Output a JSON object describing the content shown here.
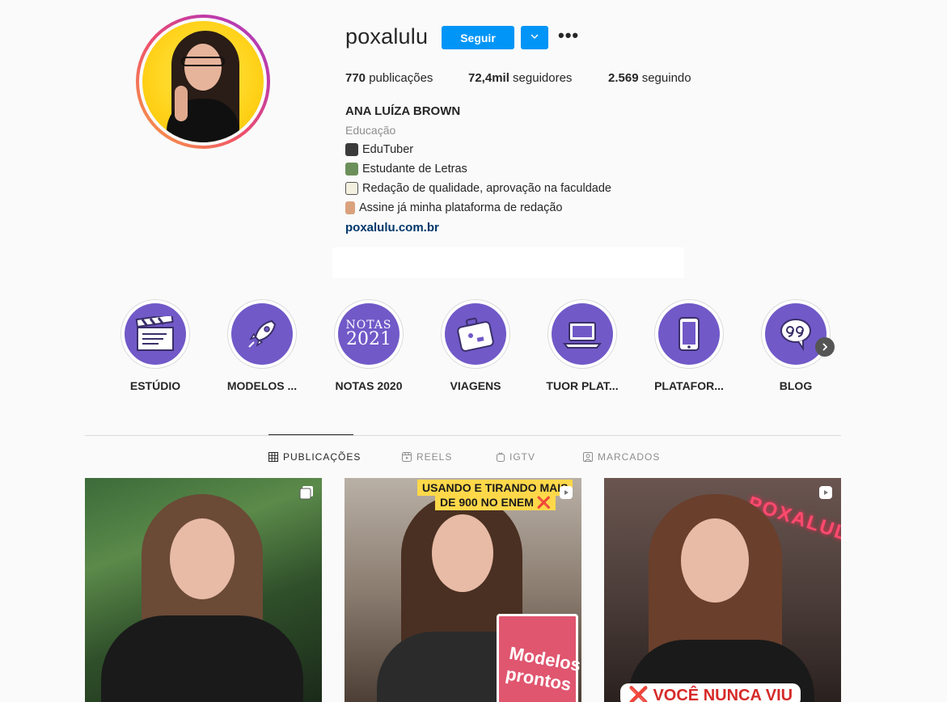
{
  "profile": {
    "username": "poxalulu",
    "follow_label": "Seguir",
    "stats": {
      "posts_count": "770",
      "posts_label": "publicações",
      "followers_count": "72,4mil",
      "followers_label": "seguidores",
      "following_count": "2.569",
      "following_label": "seguindo"
    },
    "full_name": "ANA LUÍZA BROWN",
    "category": "Educação",
    "bio": [
      {
        "text": "EduTuber",
        "icon": "school-bus-emoji"
      },
      {
        "text": "Estudante de Letras",
        "icon": "student-emoji"
      },
      {
        "text": "Redação de qualidade, aprovação na faculdade",
        "icon": "memo-emoji"
      },
      {
        "text": "Assine já minha plataforma de redação",
        "icon": "pointing-down-emoji"
      }
    ],
    "website": "poxalulu.com.br"
  },
  "highlights": [
    {
      "label": "ESTÚDIO",
      "icon": "clapperboard-icon"
    },
    {
      "label": "MODELOS ...",
      "icon": "rocket-icon"
    },
    {
      "label": "NOTAS 2020",
      "icon": "notas-2021-text",
      "cover_text_line1": "NOTAS",
      "cover_text_line2": "2021"
    },
    {
      "label": "VIAGENS",
      "icon": "suitcase-icon"
    },
    {
      "label": "TUOR PLAT...",
      "icon": "laptop-icon"
    },
    {
      "label": "PLATAFOR...",
      "icon": "tablet-icon"
    },
    {
      "label": "BLOG",
      "icon": "speech-bubble-quote-icon"
    }
  ],
  "tabs": [
    {
      "label": "PUBLICAÇÕES",
      "active": true,
      "icon": "grid-icon"
    },
    {
      "label": "REELS",
      "active": false,
      "icon": "reels-icon"
    },
    {
      "label": "IGTV",
      "active": false,
      "icon": "igtv-icon"
    },
    {
      "label": "MARCADOS",
      "active": false,
      "icon": "tagged-icon"
    }
  ],
  "posts": [
    {
      "type": "carousel",
      "icon": "carousel-icon"
    },
    {
      "type": "reel",
      "icon": "reel-icon",
      "caption_line1": "USANDO E TIRANDO MAIS",
      "caption_line2": "DE 900 NO ENEM ❌",
      "book_text": "Modelos prontos"
    },
    {
      "type": "reel",
      "icon": "reel-icon",
      "caption": "❌ VOCÊ NUNCA VIU",
      "neon_text": "POXALULU"
    }
  ],
  "colors": {
    "accent_blue": "#0095f6",
    "highlight_purple": "#7159c8",
    "link_blue": "#00376b",
    "text_primary": "#262626",
    "text_secondary": "#8e8e8e"
  }
}
